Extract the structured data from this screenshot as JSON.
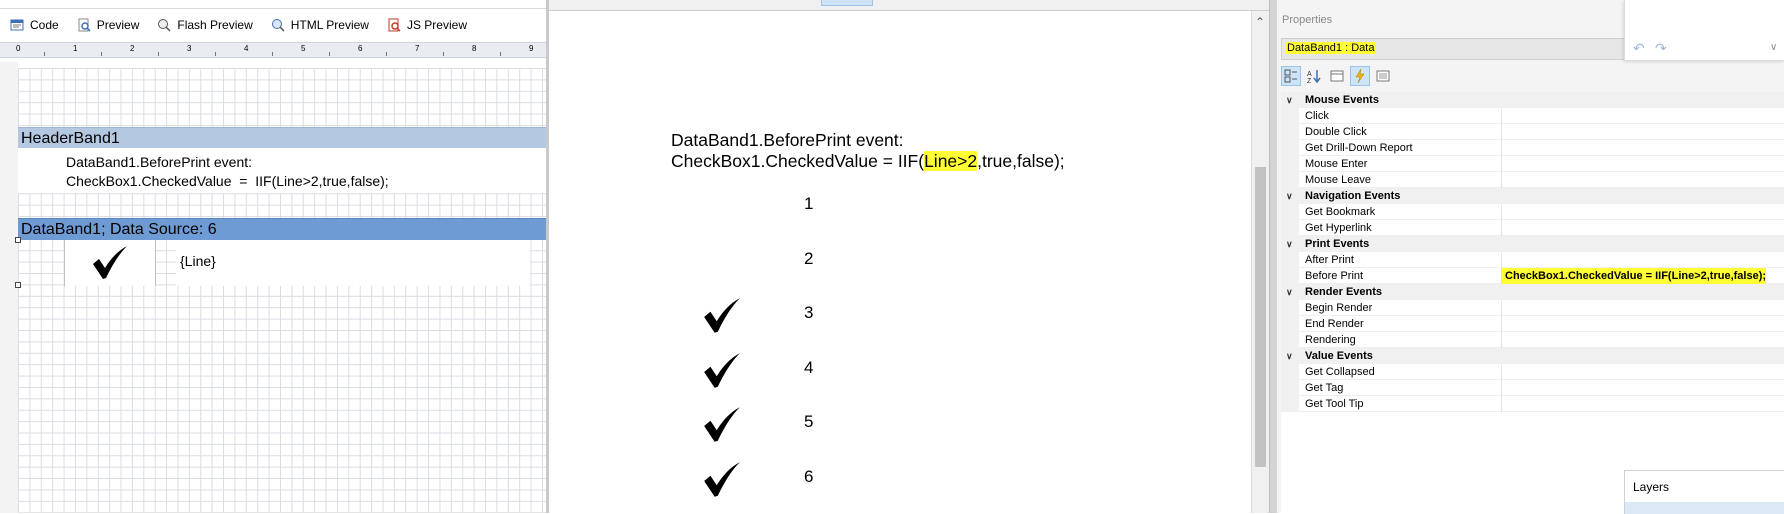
{
  "toolbar": {
    "code": "Code",
    "preview": "Preview",
    "flash_preview": "Flash Preview",
    "html_preview": "HTML Preview",
    "js_preview": "JS Preview"
  },
  "ruler": {
    "marks": [
      "0",
      "1",
      "2",
      "3",
      "4",
      "5",
      "6",
      "7",
      "8",
      "9"
    ]
  },
  "designer": {
    "header_band_title": "HeaderBand1",
    "header_text": "DataBand1.BeforePrint event:\nCheckBox1.CheckedValue  =  IIF(Line>2,true,false);",
    "data_band_title": "DataBand1; Data Source: 6",
    "checkbox_glyph": "✔",
    "line_field": "{Line}"
  },
  "preview": {
    "line1": "DataBand1.BeforePrint event:",
    "line2_prefix": "CheckBox1.CheckedValue = IIF(",
    "line2_highlight": "Line>2",
    "line2_suffix": ",true,false);",
    "rows": [
      {
        "n": "1",
        "checked": false
      },
      {
        "n": "2",
        "checked": false
      },
      {
        "n": "3",
        "checked": true
      },
      {
        "n": "4",
        "checked": true
      },
      {
        "n": "5",
        "checked": true
      },
      {
        "n": "6",
        "checked": true
      }
    ]
  },
  "properties": {
    "title": "Properties",
    "selected_object": "DataBand1 : Data",
    "categories": [
      {
        "name": "Mouse  Events",
        "items": [
          {
            "name": "Click",
            "value": ""
          },
          {
            "name": "Double Click",
            "value": ""
          },
          {
            "name": "Get Drill-Down Report",
            "value": ""
          },
          {
            "name": "Mouse Enter",
            "value": ""
          },
          {
            "name": "Mouse Leave",
            "value": ""
          }
        ]
      },
      {
        "name": "Navigation  Events",
        "items": [
          {
            "name": "Get Bookmark",
            "value": ""
          },
          {
            "name": "Get Hyperlink",
            "value": ""
          }
        ]
      },
      {
        "name": "Print  Events",
        "items": [
          {
            "name": "After Print",
            "value": ""
          },
          {
            "name": "Before Print",
            "value": "CheckBox1.CheckedValue = IIF(Line>2,true,false);",
            "highlight": true
          }
        ]
      },
      {
        "name": "Render  Events",
        "items": [
          {
            "name": "Begin Render",
            "value": ""
          },
          {
            "name": "End Render",
            "value": ""
          },
          {
            "name": "Rendering",
            "value": ""
          }
        ]
      },
      {
        "name": "Value  Events",
        "items": [
          {
            "name": "Get Collapsed",
            "value": ""
          },
          {
            "name": "Get Tag",
            "value": ""
          },
          {
            "name": "Get Tool Tip",
            "value": ""
          }
        ]
      }
    ]
  },
  "layers": {
    "title": "Layers"
  },
  "colors": {
    "highlight": "#ffff33",
    "header_band": "#b5c8e2",
    "data_band": "#6f9bd4"
  }
}
